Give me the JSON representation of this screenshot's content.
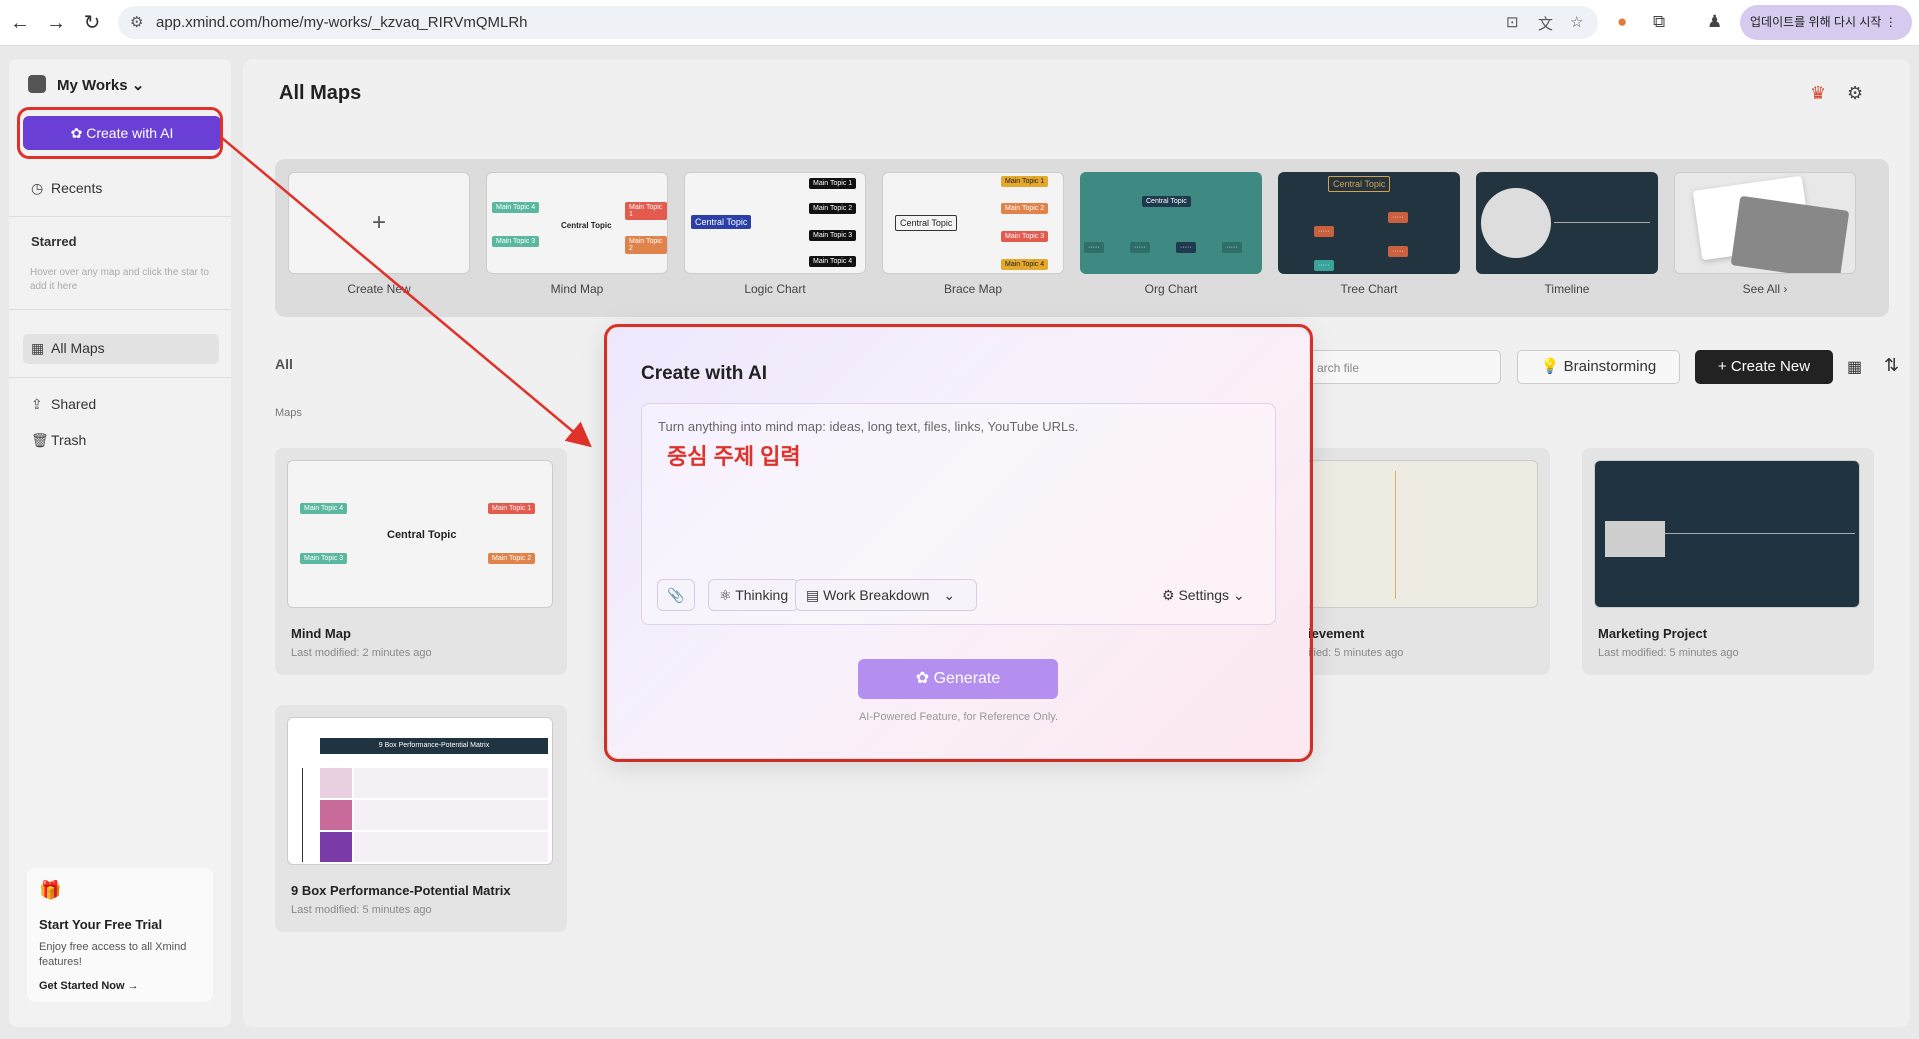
{
  "browser": {
    "url": "app.xmind.com/home/my-works/_kzvaq_RIRVmQMLRh",
    "update_label": "업데이트를 위해 다시 시작"
  },
  "sidebar": {
    "workspace": "My Works",
    "create_ai": "Create with AI",
    "recents": "Recents",
    "starred_title": "Starred",
    "starred_hint": "Hover over any map and click the star to add it here",
    "all_maps": "All Maps",
    "shared": "Shared",
    "trash": "Trash",
    "trial": {
      "title": "Start Your Free Trial",
      "desc": "Enjoy free access to all Xmind features!",
      "link": "Get Started Now"
    }
  },
  "main": {
    "title": "All Maps",
    "templates": [
      {
        "label": "Create New"
      },
      {
        "label": "Mind Map"
      },
      {
        "label": "Logic Chart"
      },
      {
        "label": "Brace Map"
      },
      {
        "label": "Org Chart"
      },
      {
        "label": "Tree Chart"
      },
      {
        "label": "Timeline"
      },
      {
        "label": "See All"
      }
    ],
    "tpl_text": {
      "central": "Central Topic",
      "topic1": "Main Topic 1",
      "topic2": "Main Topic 2",
      "topic3": "Main Topic 3",
      "topic4": "Main Topic 4"
    },
    "all_label": "All",
    "maps_label": "Maps",
    "search_placeholder": "arch file",
    "brainstorming": "Brainstorming",
    "create_new": "Create New",
    "cards": [
      {
        "title": "Mind Map",
        "modified": "Last modified: 2 minutes ago"
      },
      {
        "title": "ievement",
        "modified": "ified: 5 minutes ago"
      },
      {
        "title": "Marketing Project",
        "modified": "Last modified: 5 minutes ago"
      },
      {
        "title": "9 Box Performance-Potential Matrix",
        "modified": "Last modified: 5 minutes ago"
      }
    ],
    "matrix_title": "9 Box Performance-Potential Matrix"
  },
  "modal": {
    "title": "Create with AI",
    "placeholder": "Turn anything into mind map: ideas, long text, files, links, YouTube URLs.",
    "annotation": "중심 주제 입력",
    "thinking": "Thinking",
    "mode": "Work Breakdown",
    "settings": "Settings",
    "generate": "Generate",
    "footer": "AI-Powered Feature, for Reference Only."
  },
  "colors": {
    "accent": "#6a3fd6",
    "annotation_red": "#e0322a",
    "generate": "#b48ff0"
  }
}
